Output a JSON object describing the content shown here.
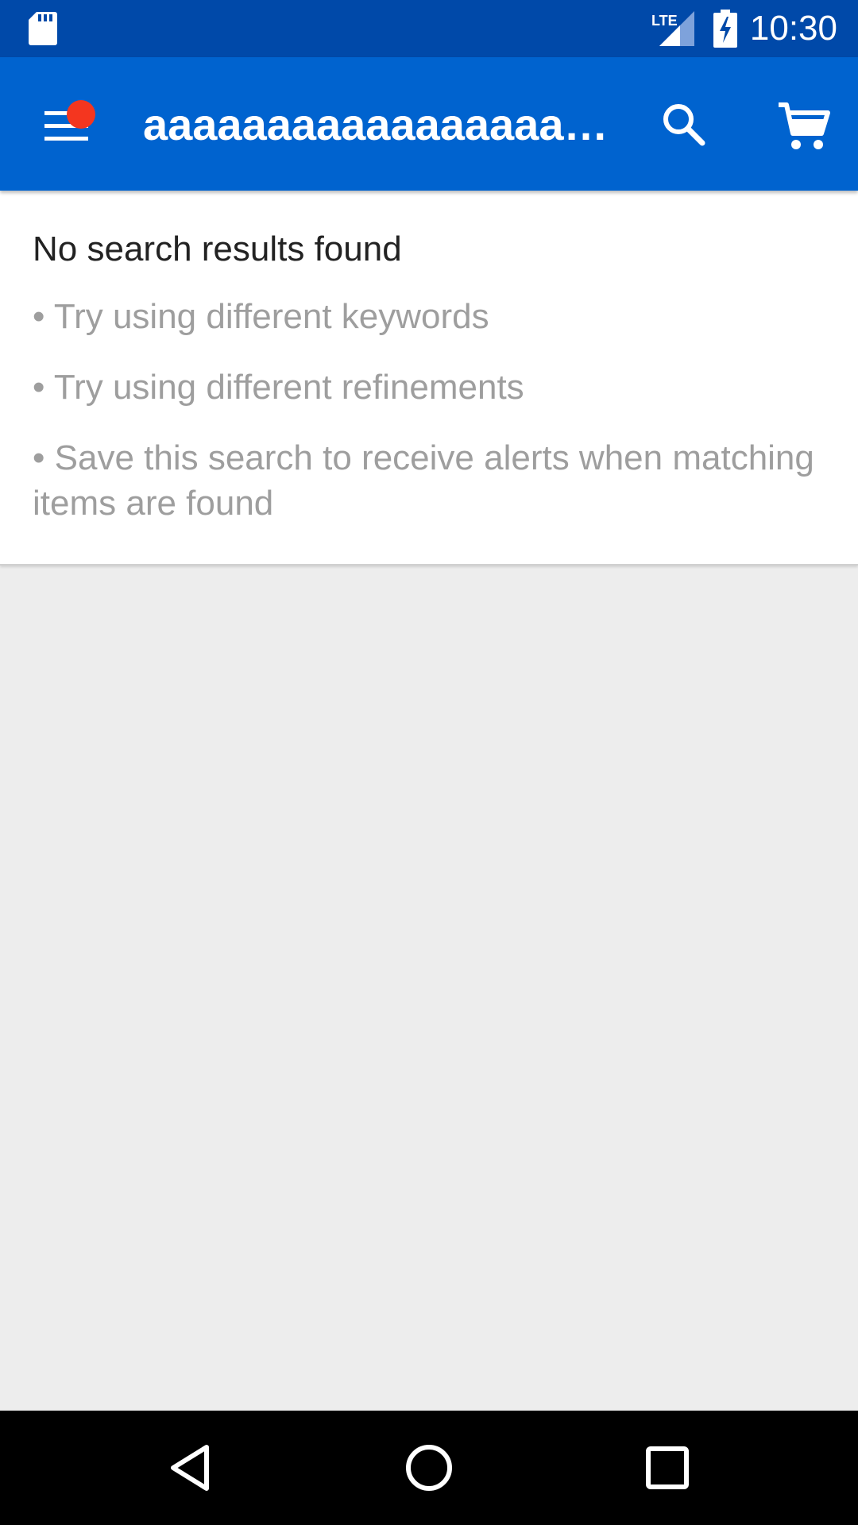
{
  "status_bar": {
    "time": "10:30",
    "network_label": "LTE",
    "icons": [
      "sd-card-icon",
      "lte-signal-icon",
      "battery-charging-icon"
    ]
  },
  "app_bar": {
    "search_query": "aaaaaaaaaaaaaaaaaaaaaaaaaaaa",
    "icons": [
      "menu-icon",
      "search-icon",
      "cart-icon"
    ],
    "has_notification_dot": true,
    "background_color": "#0063cf",
    "notification_color": "#f4361f"
  },
  "results": {
    "title": "No search results found",
    "tips": [
      "• Try using different keywords",
      "• Try using different refinements",
      "• Save this search to receive alerts when matching items are found"
    ]
  },
  "nav_bar": {
    "icons": [
      "back-icon",
      "home-icon",
      "recents-icon"
    ]
  }
}
